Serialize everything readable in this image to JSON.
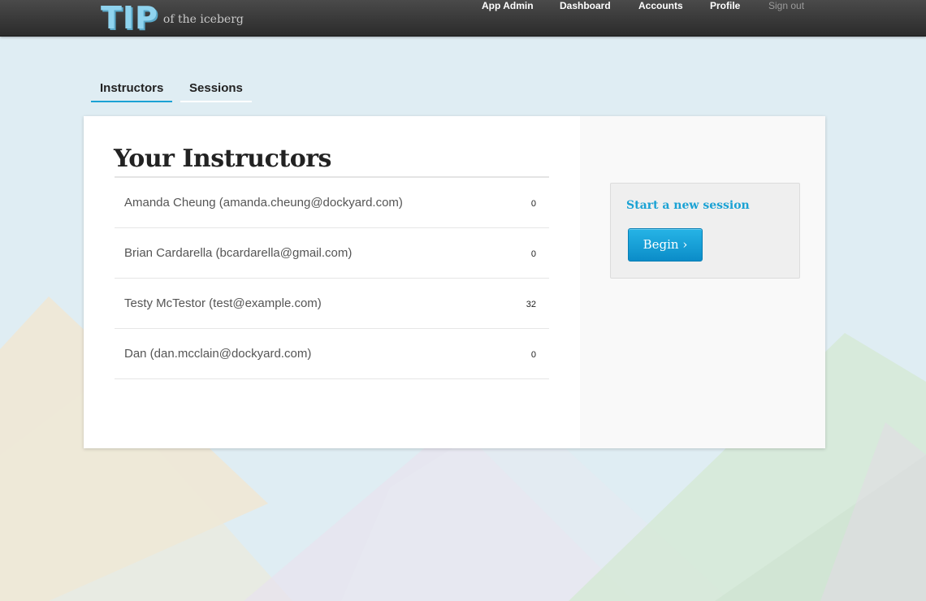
{
  "brand": {
    "mark": "TIP",
    "tagline": "of the iceberg"
  },
  "nav": {
    "items": [
      {
        "label": "App Admin"
      },
      {
        "label": "Dashboard"
      },
      {
        "label": "Accounts"
      },
      {
        "label": "Profile"
      },
      {
        "label": "Sign out"
      }
    ]
  },
  "tabs": [
    {
      "label": "Instructors",
      "active": true
    },
    {
      "label": "Sessions",
      "active": false
    }
  ],
  "main": {
    "title": "Your Instructors",
    "instructors": [
      {
        "name": "Amanda Cheung (amanda.cheung@dockyard.com)",
        "count": "0"
      },
      {
        "name": "Brian Cardarella (bcardarella@gmail.com)",
        "count": "0"
      },
      {
        "name": "Testy McTestor (test@example.com)",
        "count": "32"
      },
      {
        "name": "Dan (dan.mcclain@dockyard.com)",
        "count": "0"
      }
    ]
  },
  "session": {
    "title": "Start a new session",
    "button_label": "Begin ›"
  },
  "colors": {
    "accent": "#1ba2d4",
    "topbar": "#333333",
    "background": "#dfedf3"
  }
}
